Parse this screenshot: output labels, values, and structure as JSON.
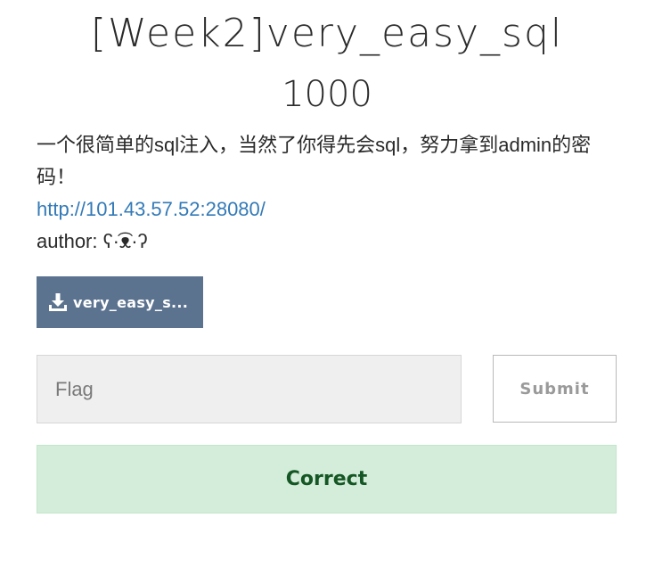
{
  "challenge": {
    "title": "[Week2]very_easy_sql",
    "points": "1000",
    "description": "一个很简单的sql注入，当然了你得先会sql，努力拿到admin的密码！",
    "link": "http://101.43.57.52:28080/",
    "author": "author: ʕ·͡ᴥ·ʔ"
  },
  "file": {
    "icon": "download-icon",
    "label": "very_easy_s..."
  },
  "form": {
    "placeholder": "Flag",
    "submit_label": "Submit"
  },
  "result": {
    "message": "Correct"
  },
  "colors": {
    "file_button": "#5c7390",
    "link": "#337ab7",
    "success_bg": "#d4edda",
    "success_text": "#155724"
  }
}
